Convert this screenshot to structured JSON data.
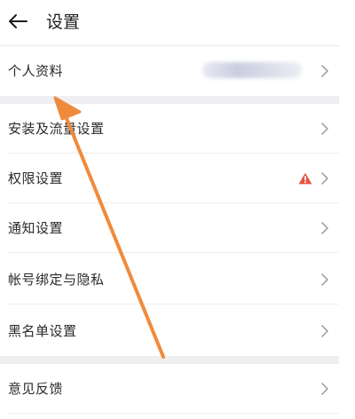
{
  "header": {
    "title": "设置",
    "back_icon": "back-arrow-icon"
  },
  "sections": {
    "profile": {
      "label": "个人资料"
    },
    "install": {
      "label": "安装及流量设置"
    },
    "permissions": {
      "label": "权限设置",
      "warning_icon": "warning-icon",
      "warning_color": "#e5533d"
    },
    "notifications": {
      "label": "通知设置"
    },
    "account": {
      "label": "帐号绑定与隐私"
    },
    "blacklist": {
      "label": "黑名单设置"
    },
    "feedback": {
      "label": "意见反馈"
    }
  },
  "annotation": {
    "color": "#f08a3c",
    "icon": "annotation-arrow"
  },
  "colors": {
    "chevron": "#9a9a9a",
    "section_gap": "#efeff1"
  }
}
